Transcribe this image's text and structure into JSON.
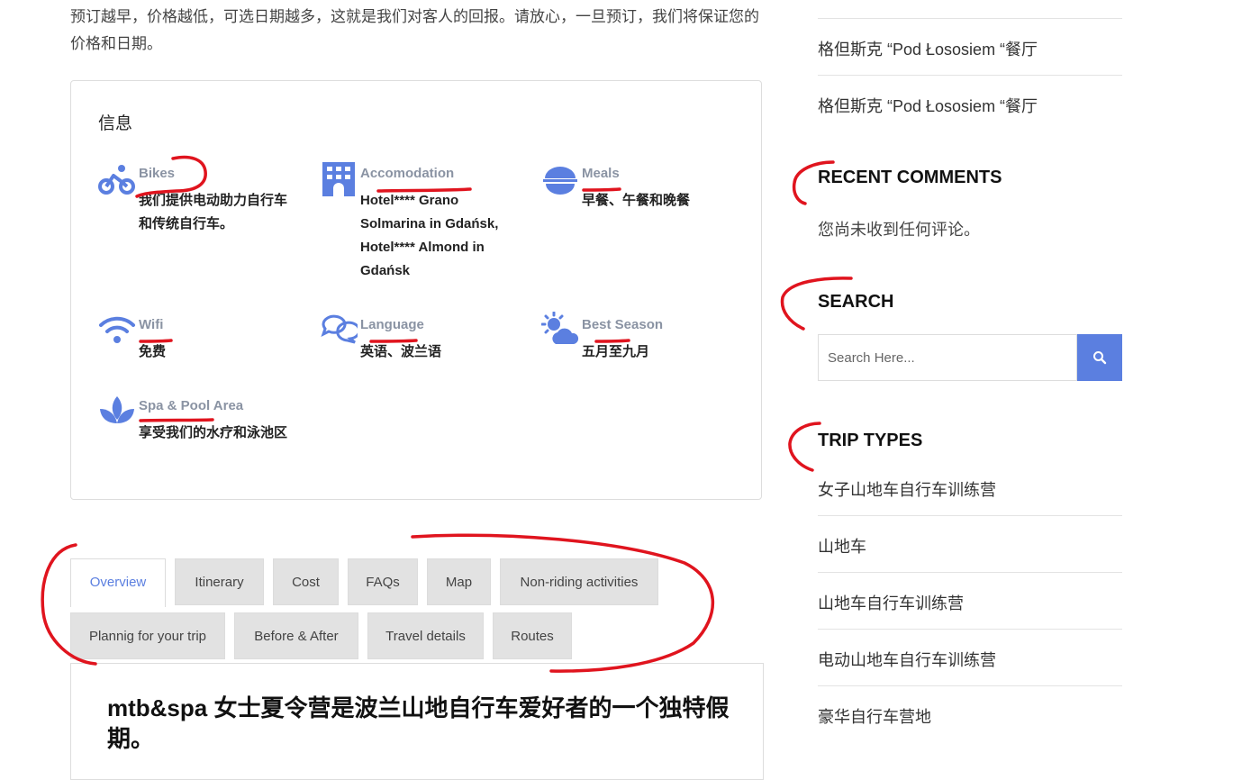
{
  "intro": {
    "text": "预订越早，价格越低，可选日期越多，这就是我们对客人的回报。请放心，一旦预订，我们将保证您的价格和日期。"
  },
  "info": {
    "title": "信息",
    "items": [
      {
        "icon": "bike-icon",
        "label": "Bikes",
        "value": "我们提供电动助力自行车和传统自行车。"
      },
      {
        "icon": "hotel-icon",
        "label": "Accomodation",
        "value": "Hotel**** Grano Solmarina in Gdańsk, Hotel**** Almond in Gdańsk"
      },
      {
        "icon": "meals-icon",
        "label": "Meals",
        "value": "早餐、午餐和晚餐"
      },
      {
        "icon": "wifi-icon",
        "label": "Wifi",
        "value": "免费"
      },
      {
        "icon": "language-icon",
        "label": "Language",
        "value": "英语、波兰语"
      },
      {
        "icon": "weather-icon",
        "label": "Best Season",
        "value": "五月至九月"
      },
      {
        "icon": "spa-icon",
        "label": "Spa & Pool Area",
        "value": "享受我们的水疗和泳池区"
      }
    ]
  },
  "tabs": {
    "items": [
      "Overview",
      "Itinerary",
      "Cost",
      "FAQs",
      "Map",
      "Non-riding activities",
      "Plannig for your trip",
      "Before & After",
      "Travel details",
      "Routes"
    ],
    "active": "Overview"
  },
  "content": {
    "title": "mtb&spa 女士夏令营是波兰山地自行车爱好者的一个独特假期。"
  },
  "sidebar": {
    "posts": [
      "格但斯克 “Pod Łososiem “餐厅",
      "格但斯克 “Pod Łososiem “餐厅"
    ],
    "recent_comments": {
      "heading": "RECENT COMMENTS",
      "text": "您尚未收到任何评论。"
    },
    "search": {
      "heading": "SEARCH",
      "placeholder": "Search Here..."
    },
    "trip_types": {
      "heading": "TRIP TYPES",
      "items": [
        "女子山地车自行车训练营",
        "山地车",
        "山地车自行车训练营",
        "电动山地车自行车训练营",
        "豪华自行车营地"
      ]
    }
  },
  "colors": {
    "accent": "#5b7fe0",
    "annotation": "#e0141e"
  }
}
